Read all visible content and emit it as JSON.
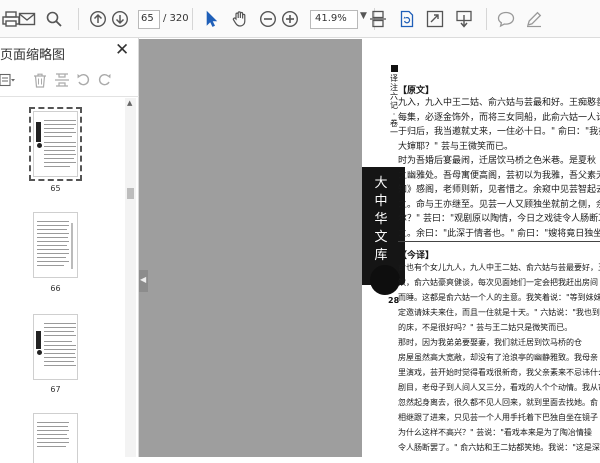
{
  "toolbar": {
    "page_current": "65",
    "page_total": "/ 320",
    "zoom": "41.9%",
    "icons": [
      "printer-icon",
      "mail-icon",
      "search-icon",
      "page-up-icon",
      "page-down-icon",
      "select-cursor-icon",
      "hand-icon",
      "zoom-out-icon",
      "zoom-in-icon",
      "fit-page-icon",
      "rotate-icon",
      "fullscreen-icon",
      "scroll-mode-icon",
      "comment-icon",
      "pen-icon"
    ]
  },
  "panel": {
    "title": "页面缩略图",
    "thumbnails": [
      {
        "label": "65",
        "selected": true
      },
      {
        "label": "66",
        "selected": false
      },
      {
        "label": "67",
        "selected": false
      }
    ]
  },
  "page": {
    "vertical_header": [
      "译",
      "注",
      "六",
      "记",
      "·",
      "卷",
      "一"
    ],
    "side_title": [
      "大",
      "中",
      "华",
      "文",
      "库"
    ],
    "page_number": "28",
    "section1": "【原文】",
    "section1_lines": [
      "九入，九入中王二姑、俞六姑与芸最和好。王痴憨善饮",
      "每集，必逐金饰外，而将三女同船，此俞六姑一人计祖。",
      "于归后，我当邀就丈来，一住必十日。\" 俞曰：\"我亦来此",
      "大婶耶？\" 芸与王微笑而已。",
      "时为吾婚后宴最闹，迁居饮马桥之色米巷。是夏秋",
      "之幽雅处。吾母寓便高阁，芸初以为我雅，吾父素无安",
      "知》感阁，老师则新，见者惜之。余窥中见芸智起去，良久",
      "之。命与王亦继至。见芸一人又顾独坐就前之侧，余",
      "尔？\" 芸曰：\"观剧原以陶情，今日之戏徒令人肠断耳。\"",
      "之。余曰：\"此深于情者也。\" 俞曰：\"嫂将竟日独坐于此"
    ],
    "section2": "【今译】",
    "section2_lines": [
      "俞也有个女儿九人，九人中王二姑、俞六姑与芸最要好，王",
      "饮，俞六姑豪爽健谈，每次见面她们一定会把我赶出房间",
      "而睡。这都是俞六姑一个人的主意。我笑着说：\"等到妹妹嫁",
      "定邀请妹夫来住，而且一住就是十天。\" 六姑说：\"我也到",
      "的床，不是很好吗？\" 芸与王二姑只是微笑而已。",
      "那时，因为我弟弟要娶妻，我们就迁居到饮马桥的仓",
      "房屋虽然高大宽敞，却没有了沧浪亭的幽静雅致。我母亲",
      "里演戏，芸开始时觉得看戏很新奇，我父亲素来不忌讳什么",
      "剧目，老母子到人间人又三分，看戏的人个个动情。我从帘",
      "忽然起身离去，很久都不见人回来，就到里面去找她。俞",
      "相继跟了进来，只见芸一个人用手托着下巴独自坐在镜子",
      "为什么这样不高兴？\" 芸说：\"看戏本来是为了陶冶情操",
      "令人肠断罢了。\" 俞六姑和王二姑都笑她。我说：\"这是深",
      "的人啊！\" 俞六姑说：\"嫂子准备整天独自坐在这里吗？\""
    ]
  }
}
